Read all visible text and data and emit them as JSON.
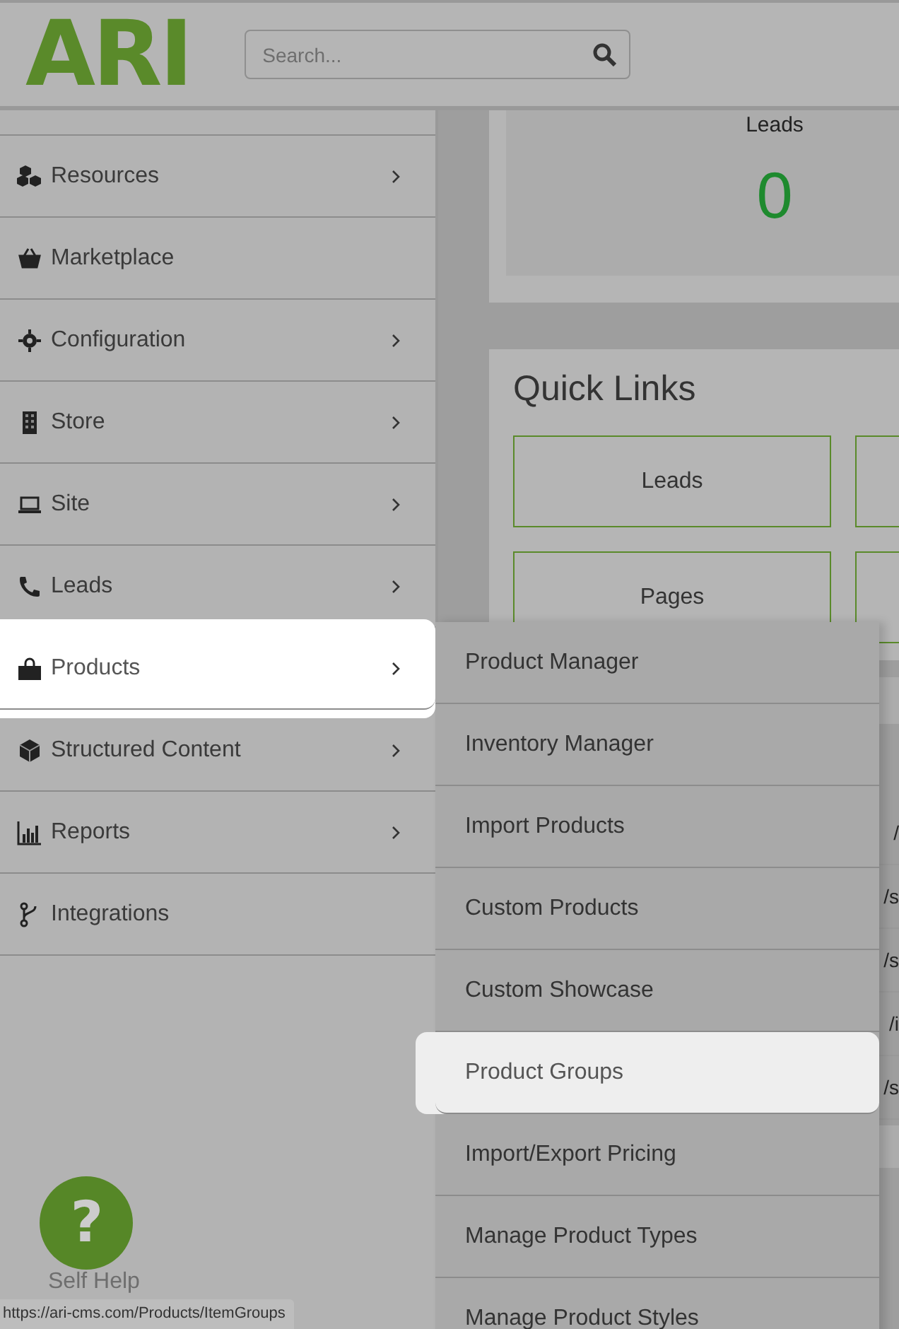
{
  "header": {
    "logo": "ARI",
    "search": {
      "placeholder": "Search..."
    }
  },
  "sidebar": {
    "items": [
      {
        "label": "Resources",
        "has_submenu": true,
        "highlighted": false
      },
      {
        "label": "Marketplace",
        "has_submenu": false,
        "highlighted": false
      },
      {
        "label": "Configuration",
        "has_submenu": true,
        "highlighted": false
      },
      {
        "label": "Store",
        "has_submenu": true,
        "highlighted": false
      },
      {
        "label": "Site",
        "has_submenu": true,
        "highlighted": false
      },
      {
        "label": "Leads",
        "has_submenu": true,
        "highlighted": false
      },
      {
        "label": "Products",
        "has_submenu": true,
        "highlighted": true
      },
      {
        "label": "Structured Content",
        "has_submenu": true,
        "highlighted": false
      },
      {
        "label": "Reports",
        "has_submenu": true,
        "highlighted": false
      },
      {
        "label": "Integrations",
        "has_submenu": false,
        "highlighted": false
      }
    ]
  },
  "stats_card": {
    "label": "Leads",
    "value": "0"
  },
  "quick_links": {
    "title": "Quick Links",
    "links": [
      {
        "label": "Leads"
      },
      {
        "label": "Pages"
      }
    ]
  },
  "table": {
    "column_1": [
      "/",
      "/s",
      "/s",
      "/i",
      "/s"
    ]
  },
  "submenu": {
    "items": [
      {
        "label": "Product Manager",
        "highlighted": false
      },
      {
        "label": "Inventory Manager",
        "highlighted": false
      },
      {
        "label": "Import Products",
        "highlighted": false
      },
      {
        "label": "Custom Products",
        "highlighted": false
      },
      {
        "label": "Custom Showcase",
        "highlighted": false
      },
      {
        "label": "Product Groups",
        "highlighted": true
      },
      {
        "label": "Import/Export Pricing",
        "highlighted": false
      },
      {
        "label": "Manage Product Types",
        "highlighted": false
      },
      {
        "label": "Manage Product Styles",
        "highlighted": false
      }
    ]
  },
  "help": {
    "icon": "?",
    "label": "Self Help"
  },
  "status_bar": {
    "url": "https://ari-cms.com/Products/ItemGroups"
  }
}
